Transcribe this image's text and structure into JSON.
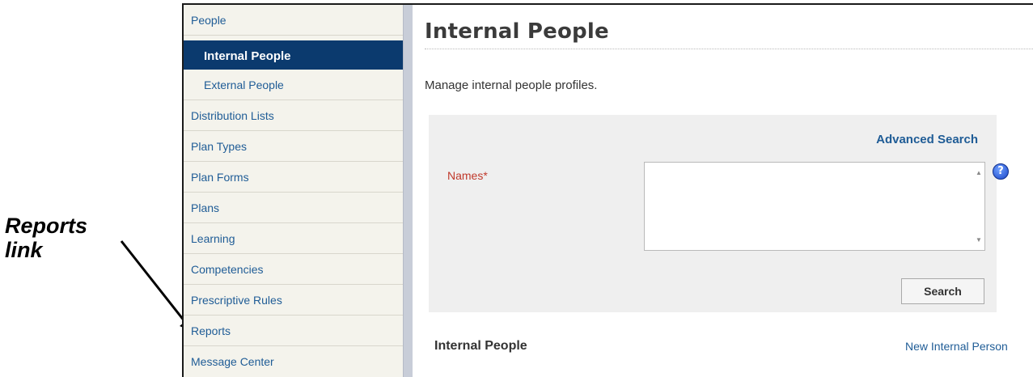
{
  "annotation": {
    "label_line1": "Reports",
    "label_line2": "link"
  },
  "sidebar": {
    "items": [
      {
        "label": "People"
      },
      {
        "label": "Internal People",
        "active": true
      },
      {
        "label": "External People"
      },
      {
        "label": "Distribution Lists"
      },
      {
        "label": "Plan Types"
      },
      {
        "label": "Plan Forms"
      },
      {
        "label": "Plans"
      },
      {
        "label": "Learning"
      },
      {
        "label": "Competencies"
      },
      {
        "label": "Prescriptive Rules"
      },
      {
        "label": "Reports"
      },
      {
        "label": "Message Center"
      }
    ]
  },
  "main": {
    "title": "Internal People",
    "description": "Manage internal people profiles.",
    "search": {
      "advanced_label": "Advanced Search",
      "names_label": "Names*",
      "names_value": "",
      "help_icon": "question-mark-icon",
      "search_button": "Search"
    },
    "results": {
      "section_title": "Internal People",
      "new_link": "New Internal Person"
    }
  },
  "colors": {
    "active_nav": "#0b3a6e",
    "link": "#1f5c96",
    "required_label": "#c0392b",
    "sidebar_bg": "#f4f3ec"
  }
}
